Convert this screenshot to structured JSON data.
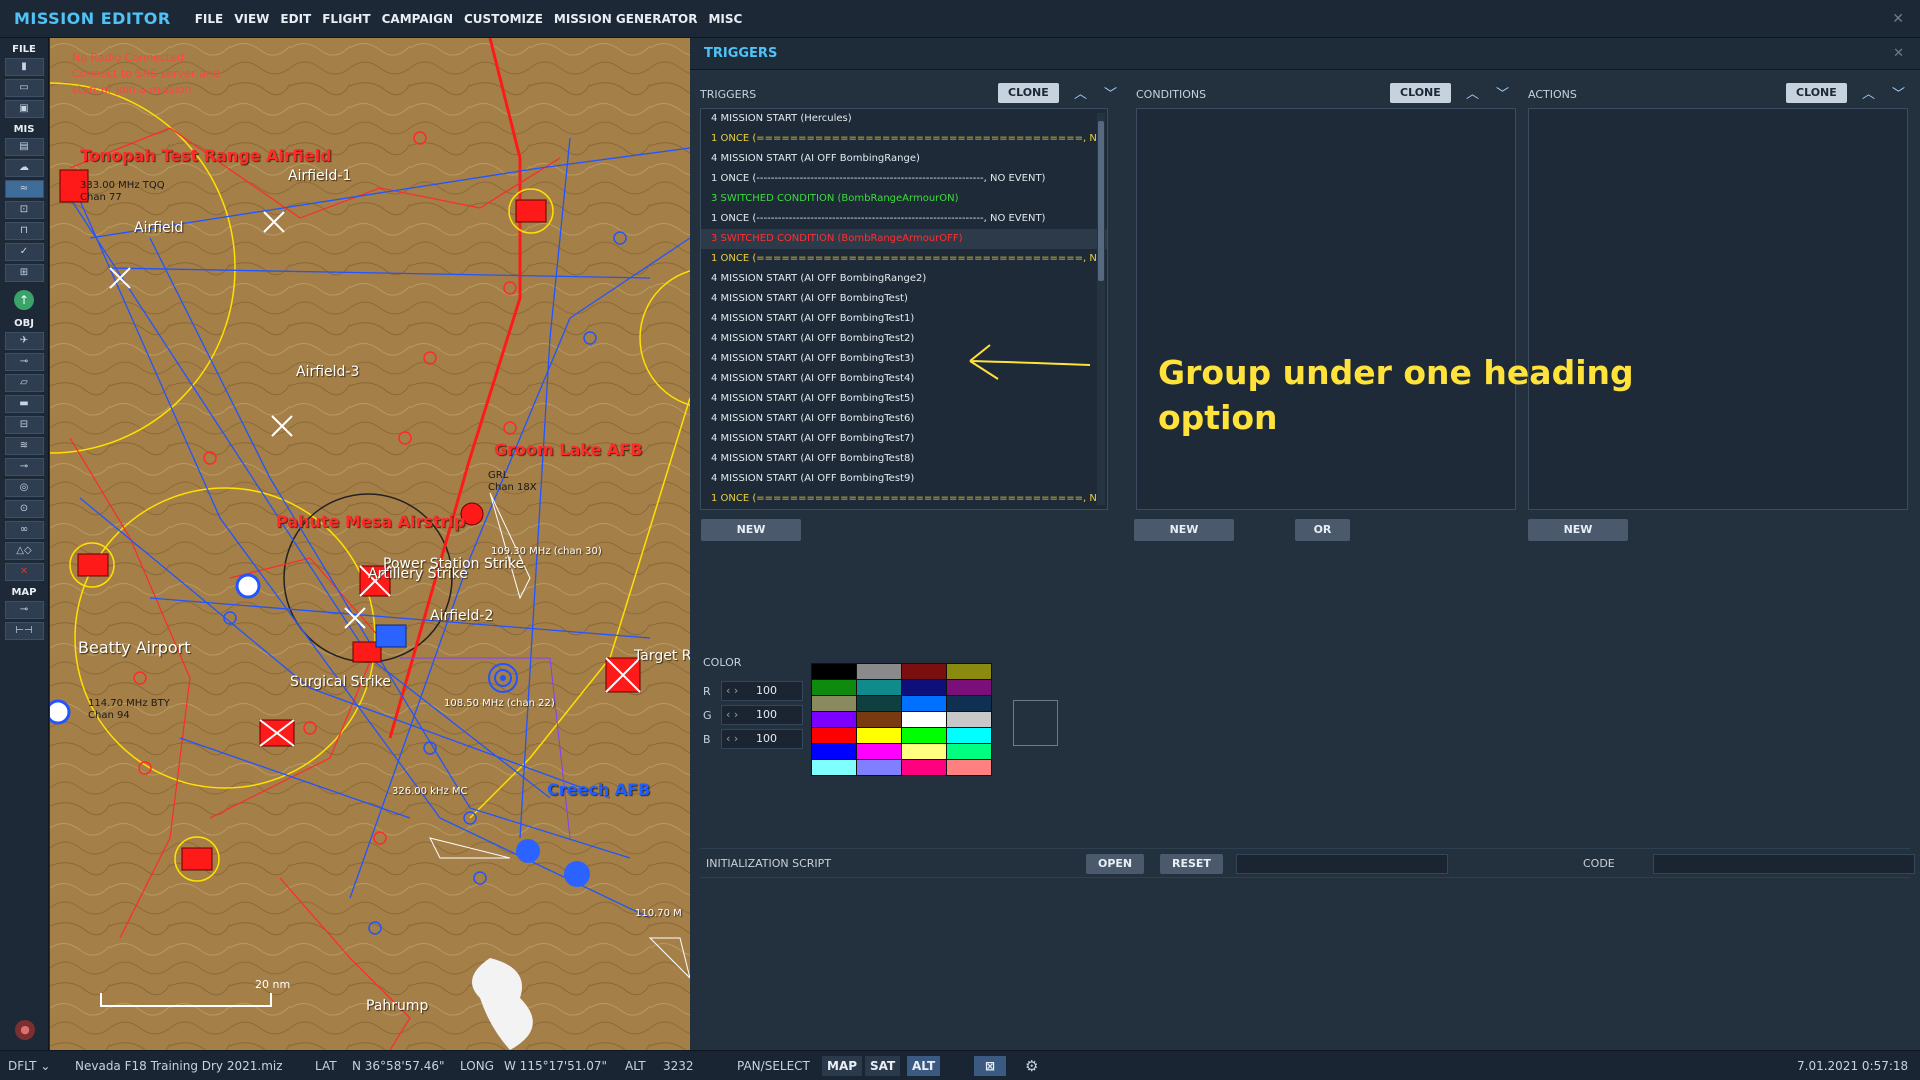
{
  "app": {
    "title": "MISSION EDITOR",
    "menu": [
      "FILE",
      "VIEW",
      "EDIT",
      "FLIGHT",
      "CAMPAIGN",
      "CUSTOMIZE",
      "MISSION GENERATOR",
      "MISC"
    ]
  },
  "toolbar": {
    "sections": [
      "FILE",
      "MIS",
      "OBJ",
      "MAP"
    ]
  },
  "map": {
    "radio_warning": [
      "No Radio Connected",
      "Connect to SRS server and",
      "start or join a mission"
    ],
    "labels": {
      "tonopah": "Tonopah Test Range Airfield",
      "airfield1": "Airfield-1",
      "airfield": "Airfield",
      "airfield3": "Airfield-3",
      "groom": "Groom Lake AFB",
      "pahute": "Pahute Mesa Airstrip",
      "power": "Power Station Strike",
      "artillery": "Artillery Strike",
      "airfield2": "Airfield-2",
      "beatty": "Beatty Airport",
      "target": "Target R",
      "surgical": "Surgical Strike",
      "creech": "Creech AFB",
      "pahrump": "Pahrump",
      "freq1": "333.00 MHz TQQ",
      "chan1": "Chan 77",
      "freq_groom": "GRL",
      "chan_groom": "Chan 18X",
      "freq2": "109.30 MHz (chan 30)",
      "freq3": "108.50 MHz (chan 22)",
      "beatty_freq": "114.70 MHz BTY",
      "beatty_chan": "Chan 94",
      "freq4": "110.70 M",
      "freq5": "326.00 kHz MC"
    },
    "scale": "20 nm"
  },
  "panel": {
    "title": "TRIGGERS",
    "triggers_label": "TRIGGERS",
    "conditions_label": "CONDITIONS",
    "actions_label": "ACTIONS",
    "clone_label": "CLONE",
    "new_label": "NEW",
    "or_label": "OR",
    "triggers": [
      {
        "text": "4 MISSION START (Hercules)",
        "color": "white"
      },
      {
        "text": "1 ONCE (=======================================, NO EVENT)",
        "color": "yellow"
      },
      {
        "text": "4 MISSION START (AI OFF BombingRange)",
        "color": "white"
      },
      {
        "text": "1 ONCE (---------------------------------------------------------------, NO EVENT)",
        "color": "white"
      },
      {
        "text": "3 SWITCHED CONDITION (BombRangeArmourON)",
        "color": "green"
      },
      {
        "text": "1 ONCE (---------------------------------------------------------------, NO EVENT)",
        "color": "white"
      },
      {
        "text": "3 SWITCHED CONDITION (BombRangeArmourOFF)",
        "color": "red"
      },
      {
        "text": "1 ONCE (=======================================, NO EVENT)",
        "color": "yellow"
      },
      {
        "text": "4 MISSION START (AI OFF BombingRange2)",
        "color": "white"
      },
      {
        "text": "4 MISSION START (AI OFF BombingTest)",
        "color": "white"
      },
      {
        "text": "4 MISSION START (AI OFF BombingTest1)",
        "color": "white"
      },
      {
        "text": "4 MISSION START (AI OFF BombingTest2)",
        "color": "white"
      },
      {
        "text": "4 MISSION START (AI OFF BombingTest3)",
        "color": "white"
      },
      {
        "text": "4 MISSION START (AI OFF BombingTest4)",
        "color": "white"
      },
      {
        "text": "4 MISSION START (AI OFF BombingTest5)",
        "color": "white"
      },
      {
        "text": "4 MISSION START (AI OFF BombingTest6)",
        "color": "white"
      },
      {
        "text": "4 MISSION START (AI OFF BombingTest7)",
        "color": "white"
      },
      {
        "text": "4 MISSION START (AI OFF BombingTest8)",
        "color": "white"
      },
      {
        "text": "4 MISSION START (AI OFF BombingTest9)",
        "color": "white"
      },
      {
        "text": "1 ONCE (=======================================, NO EVENT)",
        "color": "yellow"
      }
    ],
    "annotation": [
      "Group under one heading",
      "option"
    ],
    "color": {
      "label": "COLOR",
      "r_label": "R",
      "g_label": "G",
      "b_label": "B",
      "r": "100",
      "g": "100",
      "b": "100",
      "palette": [
        "#000000",
        "#8a8a8a",
        "#7a0f0f",
        "#8a8a10",
        "#0f8a0f",
        "#108a8a",
        "#0f0f7a",
        "#7a0f7a",
        "#8a8a60",
        "#0f4040",
        "#0070ff",
        "#0f3050",
        "#7a00ff",
        "#7a3a0f",
        "#ffffff",
        "#c8c8c8",
        "#ff0000",
        "#ffff00",
        "#00ff00",
        "#00ffff",
        "#0000ff",
        "#ff00ff",
        "#ffff80",
        "#00ff80",
        "#80ffff",
        "#8080ff",
        "#ff0080",
        "#ff8080"
      ]
    },
    "init": {
      "label": "INITIALIZATION SCRIPT",
      "open": "OPEN",
      "reset": "RESET",
      "code_label": "CODE"
    }
  },
  "status": {
    "profile": "DFLT",
    "file": "Nevada F18 Training Dry 2021.miz",
    "lat_label": "LAT",
    "lat": "N 36°58'57.46\"",
    "long_label": "LONG",
    "long": "W 115°17'51.07\"",
    "alt_label": "ALT",
    "alt": "3232",
    "mode": "PAN/SELECT",
    "map_btn": "MAP",
    "sat_btn": "SAT",
    "alt_btn": "ALT",
    "datetime": "7.01.2021 0:57:18"
  }
}
